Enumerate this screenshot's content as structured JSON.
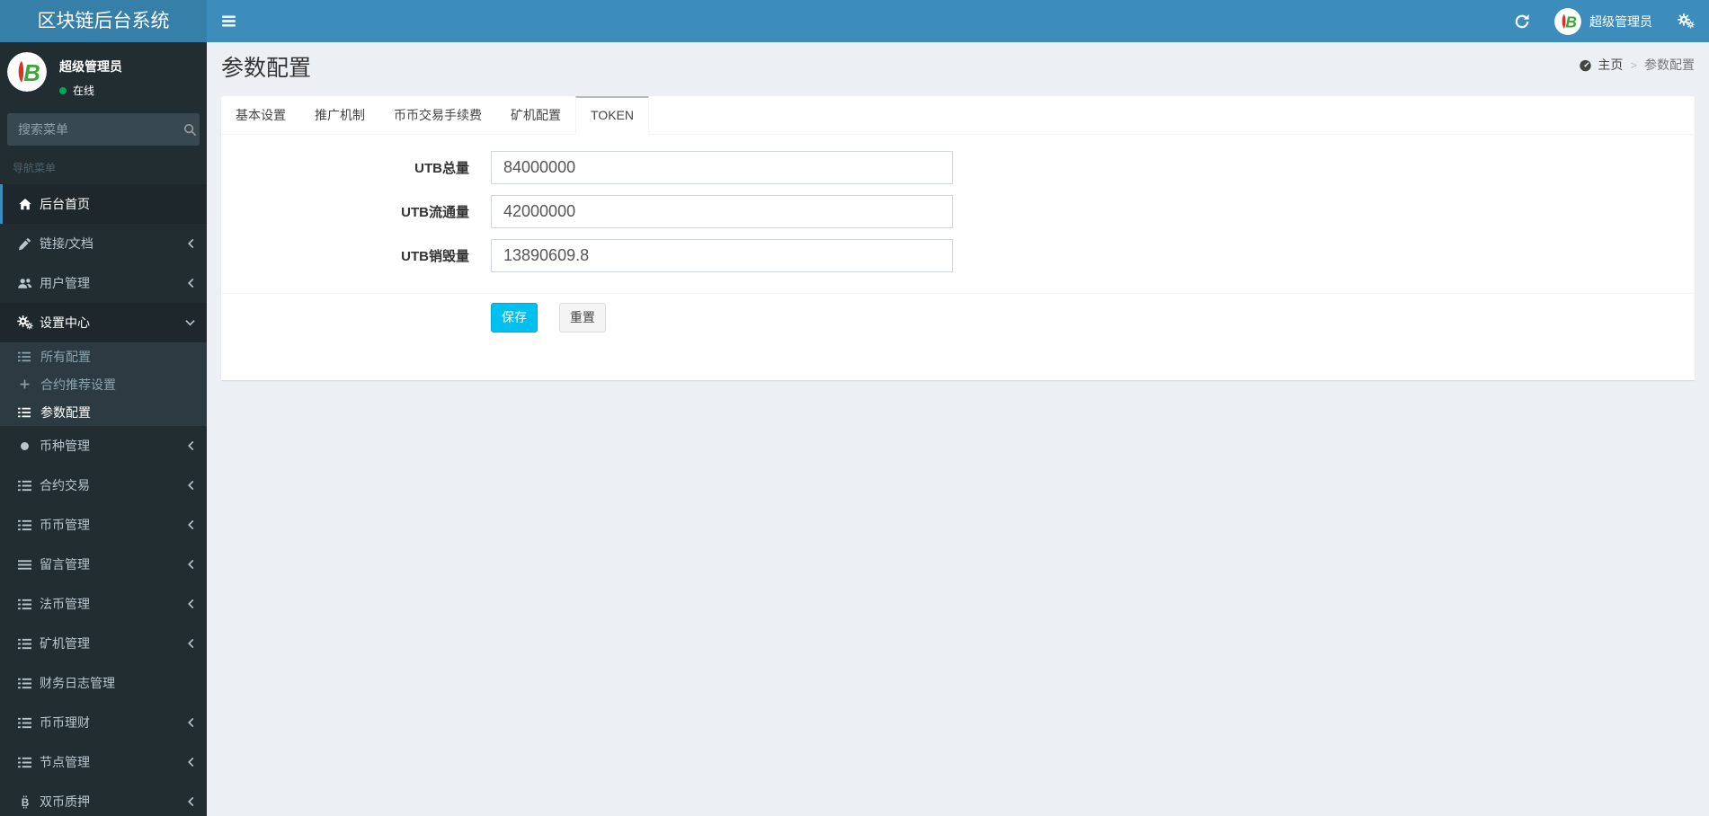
{
  "app": {
    "title": "区块链后台系统"
  },
  "navbar": {
    "user_name": "超级管理员",
    "icons": [
      "refresh-icon",
      "avatar",
      "gears-icon"
    ]
  },
  "sidebar": {
    "user": {
      "name": "超级管理员",
      "status": "在线"
    },
    "search_placeholder": "搜索菜单",
    "nav_header": "导航菜单",
    "items": [
      {
        "label": "后台首页",
        "icon": "home-icon",
        "active": true
      },
      {
        "label": "链接/文档",
        "icon": "pencil-icon"
      },
      {
        "label": "用户管理",
        "icon": "users-icon"
      },
      {
        "label": "设置中心",
        "icon": "gears-icon",
        "expanded": true
      },
      {
        "label": "币种管理",
        "icon": "circle-icon"
      },
      {
        "label": "合约交易",
        "icon": "list-icon"
      },
      {
        "label": "币币管理",
        "icon": "list-icon"
      },
      {
        "label": "留言管理",
        "icon": "bars-icon"
      },
      {
        "label": "法币管理",
        "icon": "list-icon"
      },
      {
        "label": "矿机管理",
        "icon": "list-icon"
      },
      {
        "label": "财务日志管理",
        "icon": "list-icon"
      },
      {
        "label": "币币理财",
        "icon": "list-icon"
      },
      {
        "label": "节点管理",
        "icon": "list-icon"
      },
      {
        "label": "双币质押",
        "icon": "btc-icon"
      }
    ],
    "subitems": [
      {
        "label": "所有配置",
        "icon": "list-icon"
      },
      {
        "label": "合约推荐设置",
        "icon": "plus-icon"
      },
      {
        "label": "参数配置",
        "icon": "list-icon",
        "active": true
      }
    ]
  },
  "content": {
    "page_title": "参数配置",
    "breadcrumb": {
      "home": "主页",
      "separator": ">",
      "current": "参数配置"
    },
    "tabs": [
      {
        "label": "基本设置"
      },
      {
        "label": "推广机制"
      },
      {
        "label": "币币交易手续费"
      },
      {
        "label": "矿机配置"
      },
      {
        "label": "TOKEN",
        "active": true
      }
    ],
    "form": {
      "fields": [
        {
          "label": "UTB总量",
          "value": "84000000"
        },
        {
          "label": "UTB流通量",
          "value": "42000000"
        },
        {
          "label": "UTB销毁量",
          "value": "13890609.8"
        }
      ],
      "save_label": "保存",
      "reset_label": "重置"
    }
  },
  "colors": {
    "navbar": "#3c8dbc",
    "logo_bg": "#367fa9",
    "sidebar_bg": "#222d32",
    "submenu_bg": "#2c3b41",
    "active_item_bg": "#1e282c",
    "active_tab_top_border": "#b5bac0",
    "save_button": "#00c0ef",
    "online_dot": "#00a65a",
    "page_bg": "#ecf0f5"
  }
}
